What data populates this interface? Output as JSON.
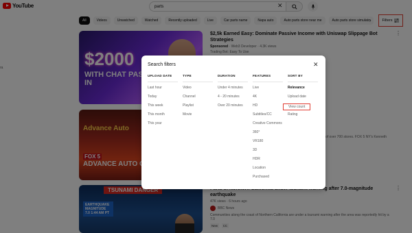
{
  "header": {
    "logo_text": "YouTube",
    "search_value": "parts",
    "icons": [
      "youtube-logo",
      "close-icon",
      "search-icon",
      "mic-icon"
    ]
  },
  "chips": [
    "All",
    "Videos",
    "Unwatched",
    "Watched",
    "Recently uploaded",
    "Live",
    "Car parts name",
    "Napa auto",
    "Auto parts store near me",
    "Auto parts store simulato"
  ],
  "filters_button": {
    "label": "Filters",
    "icon": "sliders-icon"
  },
  "left_margin_text": "ra",
  "videos": [
    {
      "thumb_text_1": "$2000",
      "thumb_text_2": "WITH CHAT PASSIVE IN",
      "title": "$2,5k Earned Easy: Dominate Passive Income with Uniswap Slippage Bot Strategies",
      "sponsored": "Sponsored",
      "channel": "Web3 Developer",
      "views": "4.3K views",
      "extra": "Trading Bot: Easy To Use"
    },
    {
      "thumb_brand": "Advance Auto",
      "thumb_fox": "FOX 5",
      "thumb_text": "ADVANCE AUTO OVER 700 STORES",
      "visible_text": "of over 700 stores. FOX 5 NY's Kenneth"
    },
    {
      "thumb_banner": "TSUNAMI DANGER",
      "thumb_box": "EARTHQUAKE MAGNITUDE 7.0 1:44 AM PT",
      "title": "Parts of Northern California under tsunami warning after 7.0-magnitude earthquake",
      "views": "47K views",
      "age": "6 hours ago",
      "channel": "BBC News",
      "description": "Communities along the coast of Northern California are under a tsunami warning after the area was reportedly hit by a 7.0",
      "badges": [
        "New",
        "CC"
      ]
    }
  ],
  "modal": {
    "title": "Search filters",
    "columns": [
      {
        "header": "UPLOAD DATE",
        "options": [
          "Last hour",
          "Today",
          "This week",
          "This month",
          "This year"
        ]
      },
      {
        "header": "TYPE",
        "options": [
          "Video",
          "Channel",
          "Playlist",
          "Movie"
        ]
      },
      {
        "header": "DURATION",
        "options": [
          "Under 4 minutes",
          "4 - 20 minutes",
          "Over 20 minutes"
        ]
      },
      {
        "header": "FEATURES",
        "options": [
          "Live",
          "4K",
          "HD",
          "Subtitles/CC",
          "Creative Commons",
          "360°",
          "VR180",
          "3D",
          "HDR",
          "Location",
          "Purchased"
        ]
      },
      {
        "header": "SORT BY",
        "options": [
          "Relevance",
          "Upload date",
          "View count",
          "Rating"
        ],
        "selected": "Relevance",
        "highlighted": "View count"
      }
    ]
  }
}
